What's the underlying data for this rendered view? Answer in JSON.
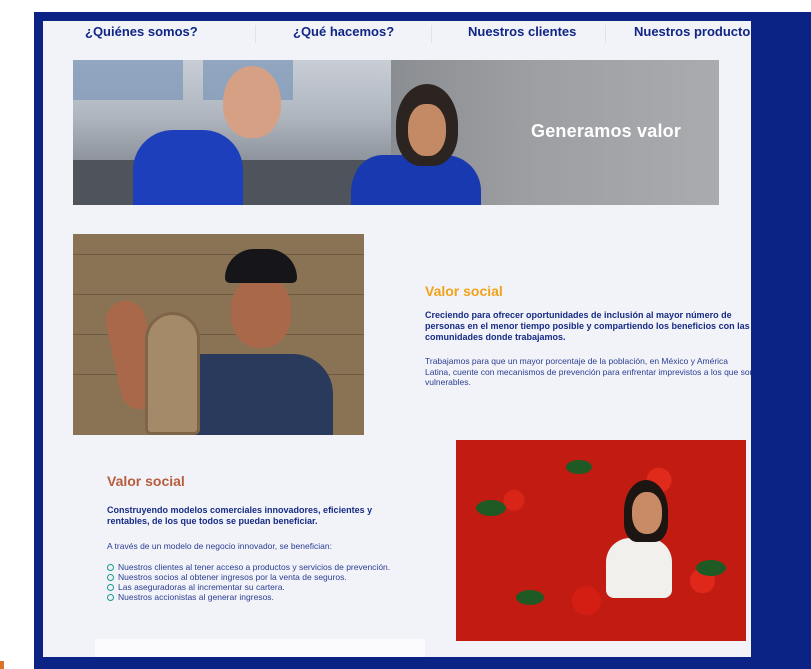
{
  "nav": {
    "items": [
      {
        "label": "¿Quiénes somos?"
      },
      {
        "label": "¿Qué hacemos?"
      },
      {
        "label": "Nuestros clientes"
      },
      {
        "label": "Nuestros productos"
      }
    ]
  },
  "banner": {
    "text": "Generamos valor"
  },
  "section1": {
    "title": "Valor social",
    "lead": "Creciendo para ofrecer oportunidades de inclusión al mayor número de personas en el menor tiempo posible y compartiendo los beneficios con las comunidades donde trabajamos.",
    "body": "Trabajamos para que un mayor porcentaje de la población, en México y América Latina, cuente con mecanismos de prevención para enfrentar imprevistos a los que son vulnerables."
  },
  "section2": {
    "title": "Valor social",
    "lead": "Construyendo modelos comerciales innovadores, eficientes y rentables, de los que todos se puedan beneficiar.",
    "intro": "A través de un modelo de negocio innovador, se benefician:",
    "items": [
      "Nuestros clientes al tener acceso a productos y servicios de prevención.",
      "Nuestros socios al obtener ingresos por la venta de seguros.",
      "Las aseguradoras al incrementar su cartera.",
      "Nuestros accionistas al generar ingresos."
    ]
  },
  "colors": {
    "frame": "#0a2384",
    "nav_text": "#102585",
    "accent_orange": "#f0a21a",
    "accent_rust": "#b85c3d",
    "bullet": "#1a9a8e"
  }
}
